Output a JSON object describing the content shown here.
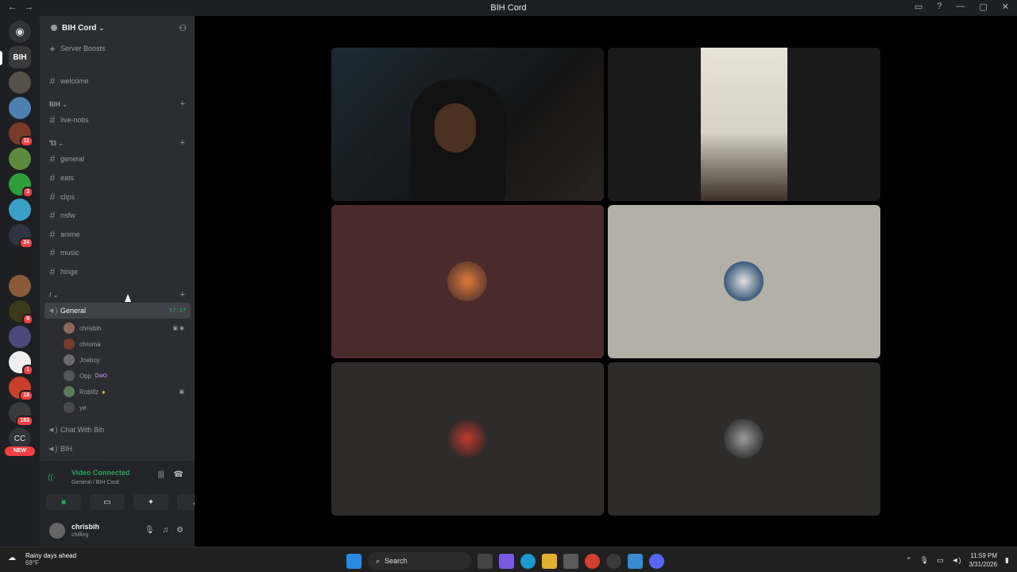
{
  "window": {
    "title": "BIH Cord",
    "back_icon": "←",
    "forward_icon": "→",
    "inbox_icon": "▭",
    "help_icon": "?",
    "minimize": "—",
    "maximize": "▢",
    "close": "✕"
  },
  "guilds": [
    {
      "badge": ""
    },
    {
      "badge": ""
    },
    {
      "badge": ""
    },
    {
      "badge": "11"
    },
    {
      "badge": ""
    },
    {
      "badge": "3"
    },
    {
      "badge": ""
    },
    {
      "badge": "24"
    },
    {
      "badge": ""
    },
    {
      "badge": ""
    },
    {
      "badge": "9"
    },
    {
      "badge": ""
    },
    {
      "badge": "1"
    },
    {
      "badge": "18"
    },
    {
      "badge": "163"
    }
  ],
  "guild_cc": "CC",
  "guild_new": "NEW",
  "server": {
    "name": "BIH Cord",
    "caret": "⌄",
    "boosts": "Server Boosts"
  },
  "channels": {
    "welcome": "welcome",
    "cat1": "BIH ⌄",
    "live": "live-notis",
    "cat2": "⅂3 ⌄",
    "list": [
      "general",
      "eats",
      "clips",
      "nsfw",
      "anime",
      "music",
      "hinge"
    ],
    "cat3": "/ ⌄",
    "voice_general": "General",
    "voice_time": "57:37",
    "voice_chat": "Chat With Bih",
    "voice_bih": "BIH"
  },
  "members": [
    {
      "name": "chrisbih",
      "tag": "",
      "icons": "▣ ◉"
    },
    {
      "name": "chroma",
      "tag": "",
      "icons": ""
    },
    {
      "name": "Joeboy",
      "tag": "",
      "icons": ""
    },
    {
      "name": "Opp",
      "tag": "OwO",
      "icons": ""
    },
    {
      "name": "Robillz",
      "tag": "",
      "icons": "▣"
    },
    {
      "name": "ye",
      "tag": "",
      "icons": ""
    }
  ],
  "voice_panel": {
    "status": "Video Connected",
    "sub": "General / BIH Cord"
  },
  "user": {
    "name": "chrisbih",
    "status": "chilling"
  },
  "taskbar": {
    "weather_title": "Rainy days ahead",
    "weather_temp": "68°F",
    "search": "Search",
    "time": "11:59 PM",
    "date": "3/31/2026"
  },
  "colors": {
    "accent_green": "#23a559",
    "sidebar": "#2b2d31",
    "guild_bar": "#1e1f22",
    "tile_red": "#4a2a2a",
    "tile_grey": "#b3b0a8",
    "tile_dark": "#2e2c2a"
  }
}
